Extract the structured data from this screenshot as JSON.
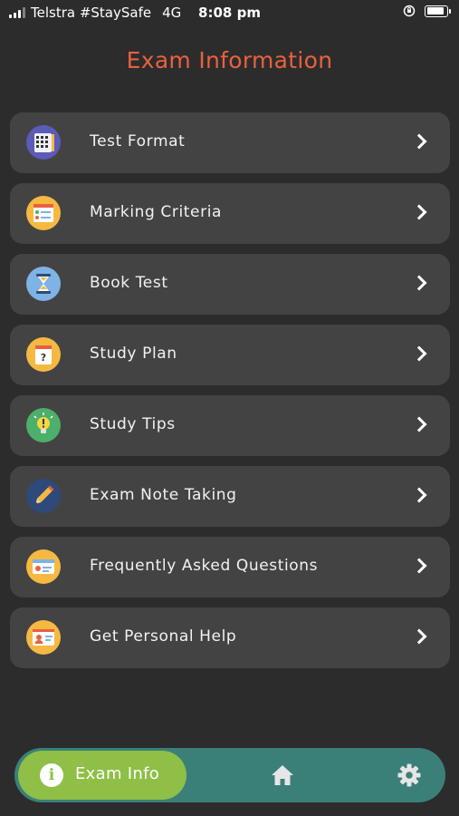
{
  "status_bar": {
    "carrier": "Telstra #StaySafe",
    "network": "4G",
    "time": "8:08 pm"
  },
  "page_title": "Exam Information",
  "menu": [
    {
      "label": "Test Format",
      "icon": "test-format-icon",
      "color": "#6a5acd"
    },
    {
      "label": "Marking Criteria",
      "icon": "marking-criteria-icon",
      "color": "#f5b942"
    },
    {
      "label": "Book Test",
      "icon": "hourglass-icon",
      "color": "#7fb2e5"
    },
    {
      "label": "Study Plan",
      "icon": "study-plan-icon",
      "color": "#f5b942"
    },
    {
      "label": "Study Tips",
      "icon": "lightbulb-icon",
      "color": "#4caf6a"
    },
    {
      "label": "Exam Note Taking",
      "icon": "pencil-icon",
      "color": "#2d4a7a"
    },
    {
      "label": "Frequently Asked Questions",
      "icon": "faq-icon",
      "color": "#f5b942"
    },
    {
      "label": "Get Personal Help",
      "icon": "personal-help-icon",
      "color": "#f5b942"
    }
  ],
  "bottom_nav": {
    "active_label": "Exam Info",
    "active_icon": "info-icon",
    "items": [
      "home-icon",
      "settings-icon"
    ]
  },
  "colors": {
    "background": "#2c2c2c",
    "card": "#434343",
    "title": "#e8613e",
    "nav_bar": "#3a8079",
    "nav_active": "#8fbf46"
  }
}
